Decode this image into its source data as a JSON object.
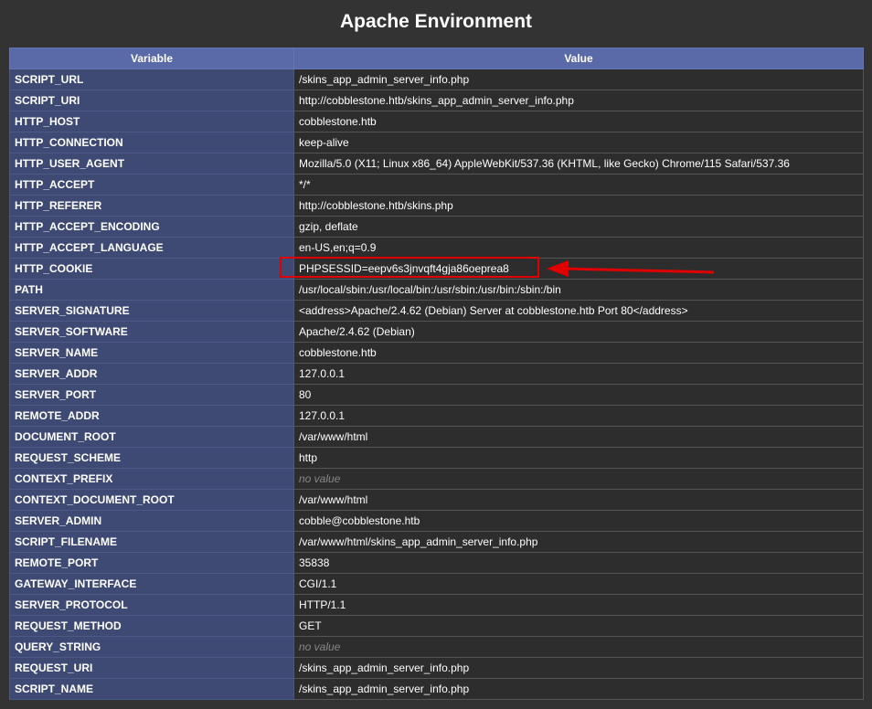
{
  "page": {
    "title": "Apache Environment"
  },
  "table": {
    "headers": [
      "Variable",
      "Value"
    ],
    "rows": [
      {
        "variable": "SCRIPT_URL",
        "value": "/skins_app_admin_server_info.php"
      },
      {
        "variable": "SCRIPT_URI",
        "value": "http://cobblestone.htb/skins_app_admin_server_info.php"
      },
      {
        "variable": "HTTP_HOST",
        "value": "cobblestone.htb"
      },
      {
        "variable": "HTTP_CONNECTION",
        "value": "keep-alive"
      },
      {
        "variable": "HTTP_USER_AGENT",
        "value": "Mozilla/5.0 (X11; Linux x86_64) AppleWebKit/537.36 (KHTML, like Gecko) Chrome/115 Safari/537.36"
      },
      {
        "variable": "HTTP_ACCEPT",
        "value": "*/*"
      },
      {
        "variable": "HTTP_REFERER",
        "value": "http://cobblestone.htb/skins.php"
      },
      {
        "variable": "HTTP_ACCEPT_ENCODING",
        "value": "gzip, deflate"
      },
      {
        "variable": "HTTP_ACCEPT_LANGUAGE",
        "value": "en-US,en;q=0.9"
      },
      {
        "variable": "HTTP_COOKIE",
        "value": "PHPSESSID=eepv6s3jnvqft4gja86oeprea8"
      },
      {
        "variable": "PATH",
        "value": "/usr/local/sbin:/usr/local/bin:/usr/sbin:/usr/bin:/sbin:/bin"
      },
      {
        "variable": "SERVER_SIGNATURE",
        "value": "<address>Apache/2.4.62 (Debian) Server at cobblestone.htb Port 80</address>"
      },
      {
        "variable": "SERVER_SOFTWARE",
        "value": "Apache/2.4.62 (Debian)"
      },
      {
        "variable": "SERVER_NAME",
        "value": "cobblestone.htb"
      },
      {
        "variable": "SERVER_ADDR",
        "value": "127.0.0.1"
      },
      {
        "variable": "SERVER_PORT",
        "value": "80"
      },
      {
        "variable": "REMOTE_ADDR",
        "value": "127.0.0.1"
      },
      {
        "variable": "DOCUMENT_ROOT",
        "value": "/var/www/html"
      },
      {
        "variable": "REQUEST_SCHEME",
        "value": "http"
      },
      {
        "variable": "CONTEXT_PREFIX",
        "value": "no value"
      },
      {
        "variable": "CONTEXT_DOCUMENT_ROOT",
        "value": "/var/www/html"
      },
      {
        "variable": "SERVER_ADMIN",
        "value": "cobble@cobblestone.htb"
      },
      {
        "variable": "SCRIPT_FILENAME",
        "value": "/var/www/html/skins_app_admin_server_info.php"
      },
      {
        "variable": "REMOTE_PORT",
        "value": "35838"
      },
      {
        "variable": "GATEWAY_INTERFACE",
        "value": "CGI/1.1"
      },
      {
        "variable": "SERVER_PROTOCOL",
        "value": "HTTP/1.1"
      },
      {
        "variable": "REQUEST_METHOD",
        "value": "GET"
      },
      {
        "variable": "QUERY_STRING",
        "value": "no value"
      },
      {
        "variable": "REQUEST_URI",
        "value": "/skins_app_admin_server_info.php"
      },
      {
        "variable": "SCRIPT_NAME",
        "value": "/skins_app_admin_server_info.php"
      }
    ]
  },
  "annotation": {
    "highlighted_row": "HTTP_COOKIE",
    "color": "#e00000",
    "icon": "red-arrow-left"
  }
}
